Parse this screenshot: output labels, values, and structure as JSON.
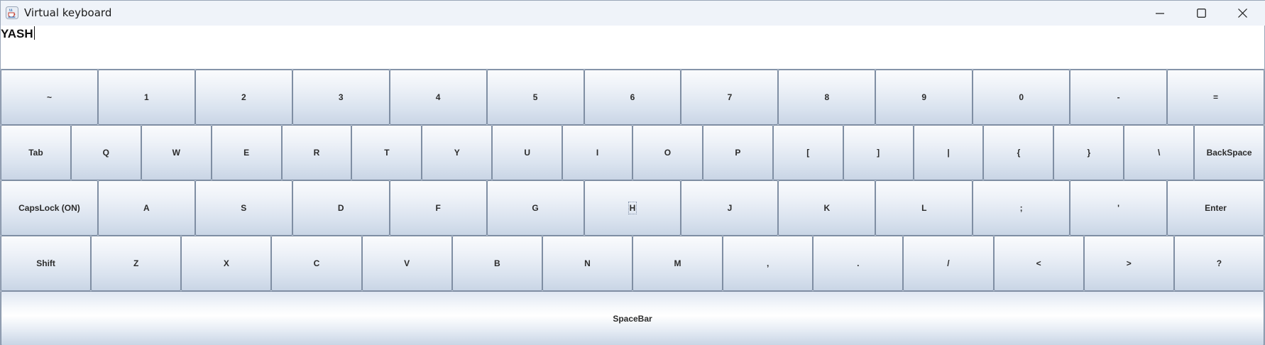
{
  "window": {
    "title": "Virtual keyboard",
    "icon": "java-cup-icon",
    "controls": [
      "minimize-icon",
      "maximize-icon",
      "close-icon"
    ]
  },
  "display": {
    "text": "YASH"
  },
  "keyboard": {
    "rows": [
      [
        "~",
        "1",
        "2",
        "3",
        "4",
        "5",
        "6",
        "7",
        "8",
        "9",
        "0",
        "-",
        "="
      ],
      [
        "Tab",
        "Q",
        "W",
        "E",
        "R",
        "T",
        "Y",
        "U",
        "I",
        "O",
        "P",
        "[",
        "]",
        "|",
        "{",
        "}",
        "\\",
        "BackSpace"
      ],
      [
        "CapsLock (ON)",
        "A",
        "S",
        "D",
        "F",
        "G",
        "H",
        "J",
        "K",
        "L",
        ";",
        "'",
        "Enter"
      ],
      [
        "Shift",
        "Z",
        "X",
        "C",
        "V",
        "B",
        "N",
        "M",
        ",",
        ".",
        "/",
        "<",
        ">",
        "?"
      ],
      [
        "SpaceBar"
      ]
    ],
    "focused_key": "H"
  }
}
